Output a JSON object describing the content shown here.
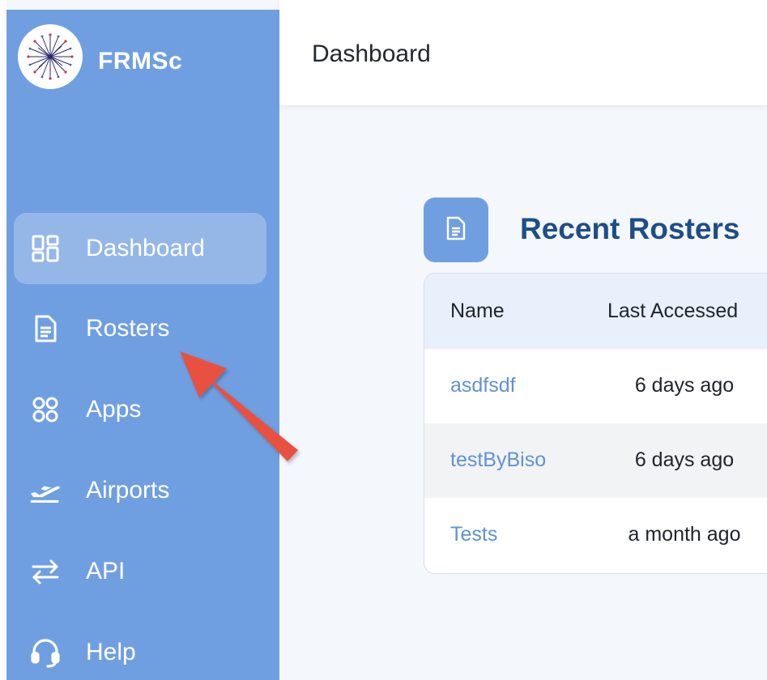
{
  "app": {
    "brand": "FRMSc"
  },
  "sidebar": {
    "items": [
      {
        "label": "Dashboard",
        "icon": "dashboard-grid-icon",
        "active": true
      },
      {
        "label": "Rosters",
        "icon": "document-icon",
        "active": false
      },
      {
        "label": "Apps",
        "icon": "apps-icon",
        "active": false
      },
      {
        "label": "Airports",
        "icon": "airplane-departure-icon",
        "active": false
      },
      {
        "label": "API",
        "icon": "arrows-exchange-icon",
        "active": false
      },
      {
        "label": "Help",
        "icon": "headset-icon",
        "active": false
      }
    ]
  },
  "header": {
    "title": "Dashboard"
  },
  "recent_rosters": {
    "title": "Recent Rosters",
    "columns": [
      "Name",
      "Last Accessed"
    ],
    "rows": [
      {
        "name": "asdfsdf",
        "last_accessed": "6 days ago"
      },
      {
        "name": "testByBiso",
        "last_accessed": "6 days ago"
      },
      {
        "name": "Tests",
        "last_accessed": "a month ago"
      }
    ]
  },
  "colors": {
    "sidebar": "#709fe1",
    "title": "#1d4e89",
    "link": "#5f93d3",
    "annotation_arrow": "#e8513f"
  }
}
